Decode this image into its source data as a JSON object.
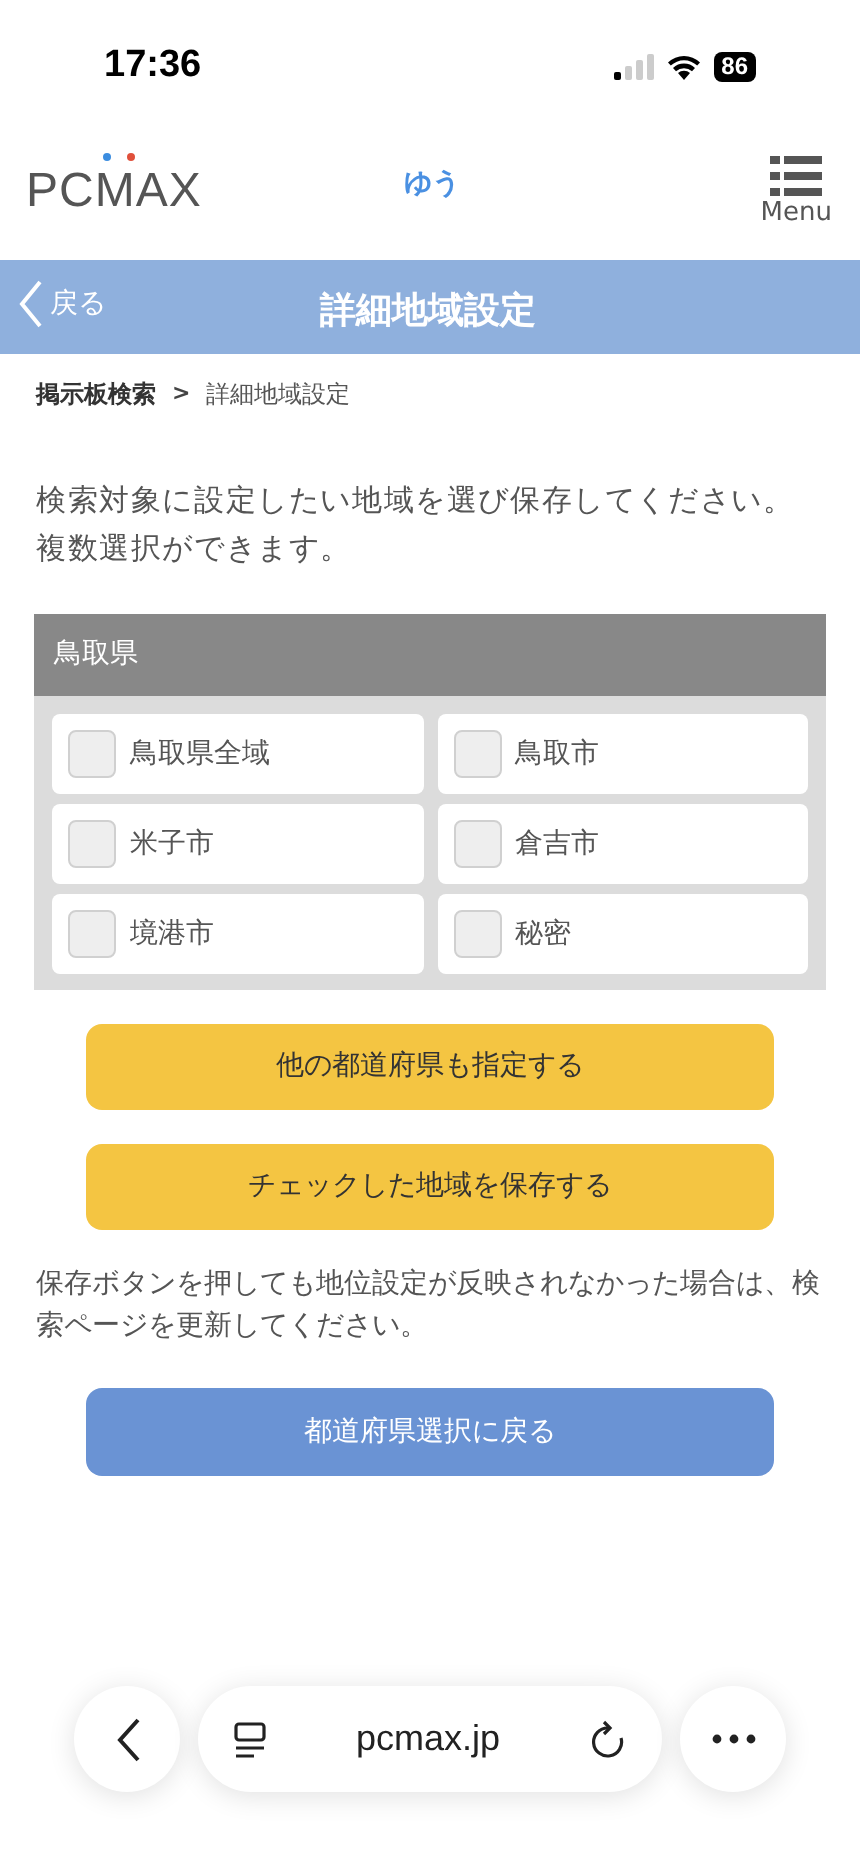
{
  "status_bar": {
    "time": "17:36",
    "battery": "86"
  },
  "header": {
    "logo": "PCMAX",
    "user": "ゆう",
    "menu_label": "Menu"
  },
  "title_bar": {
    "back": "戻る",
    "title": "詳細地域設定"
  },
  "breadcrumb": [
    {
      "label": "掲示板検索"
    },
    {
      "label": "詳細地域設定"
    }
  ],
  "breadcrumb_separator": ">",
  "intro": "検索対象に設定したい地域を選び保存してください。複数選択ができます。",
  "prefecture": {
    "name": "鳥取県",
    "areas": [
      {
        "label": "鳥取県全域",
        "checked": false
      },
      {
        "label": "鳥取市",
        "checked": false
      },
      {
        "label": "米子市",
        "checked": false
      },
      {
        "label": "倉吉市",
        "checked": false
      },
      {
        "label": "境港市",
        "checked": false
      },
      {
        "label": "秘密",
        "checked": false
      }
    ]
  },
  "buttons": [
    {
      "label": "他の都道府県も指定する",
      "kind": "yellow"
    },
    {
      "label": "チェックした地域を保存する",
      "kind": "yellow"
    }
  ],
  "note": "保存ボタンを押しても地位設定が反映されなかった場合は、検索ページを更新してください。",
  "return_button": {
    "label": "都道府県選択に戻る",
    "kind": "blue"
  },
  "browser_bar": {
    "url": "pcmax.jp"
  }
}
